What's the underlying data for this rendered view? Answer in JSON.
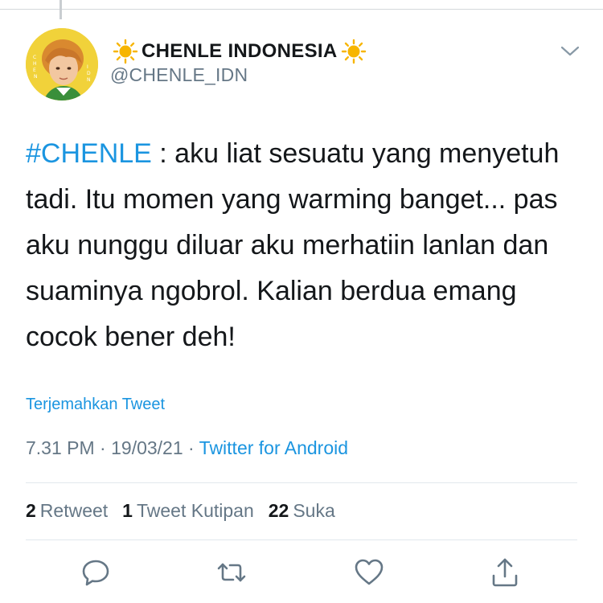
{
  "tweet": {
    "display_name": "CHENLE INDONESIA",
    "handle": "@CHENLE_IDN",
    "avatar_caption": "C H E N L E  I D N",
    "name_emoji": "sun-icon",
    "text": {
      "hashtag": "#CHENLE",
      "body": " : aku liat sesuatu yang menyetuh tadi. Itu momen yang warming banget... pas aku nunggu diluar aku merhatiin lanlan dan suaminya ngobrol. Kalian berdua emang cocok bener deh!"
    },
    "translate_label": "Terjemahkan Tweet",
    "time": "7.31 PM",
    "date": "19/03/21",
    "separator": " · ",
    "source": "Twitter for Android",
    "stats": {
      "retweets_count": "2",
      "retweets_label": "Retweet",
      "quotes_count": "1",
      "quotes_label": "Tweet Kutipan",
      "likes_count": "22",
      "likes_label": "Suka"
    }
  },
  "actions": [
    "reply-icon",
    "retweet-icon",
    "like-icon",
    "share-icon"
  ],
  "colors": {
    "link": "#1b95e0",
    "text": "#14171a",
    "muted": "#657786",
    "divider": "#e1e8ed",
    "avatar_bg": "#f1d23a",
    "sun": "#f7b500"
  }
}
